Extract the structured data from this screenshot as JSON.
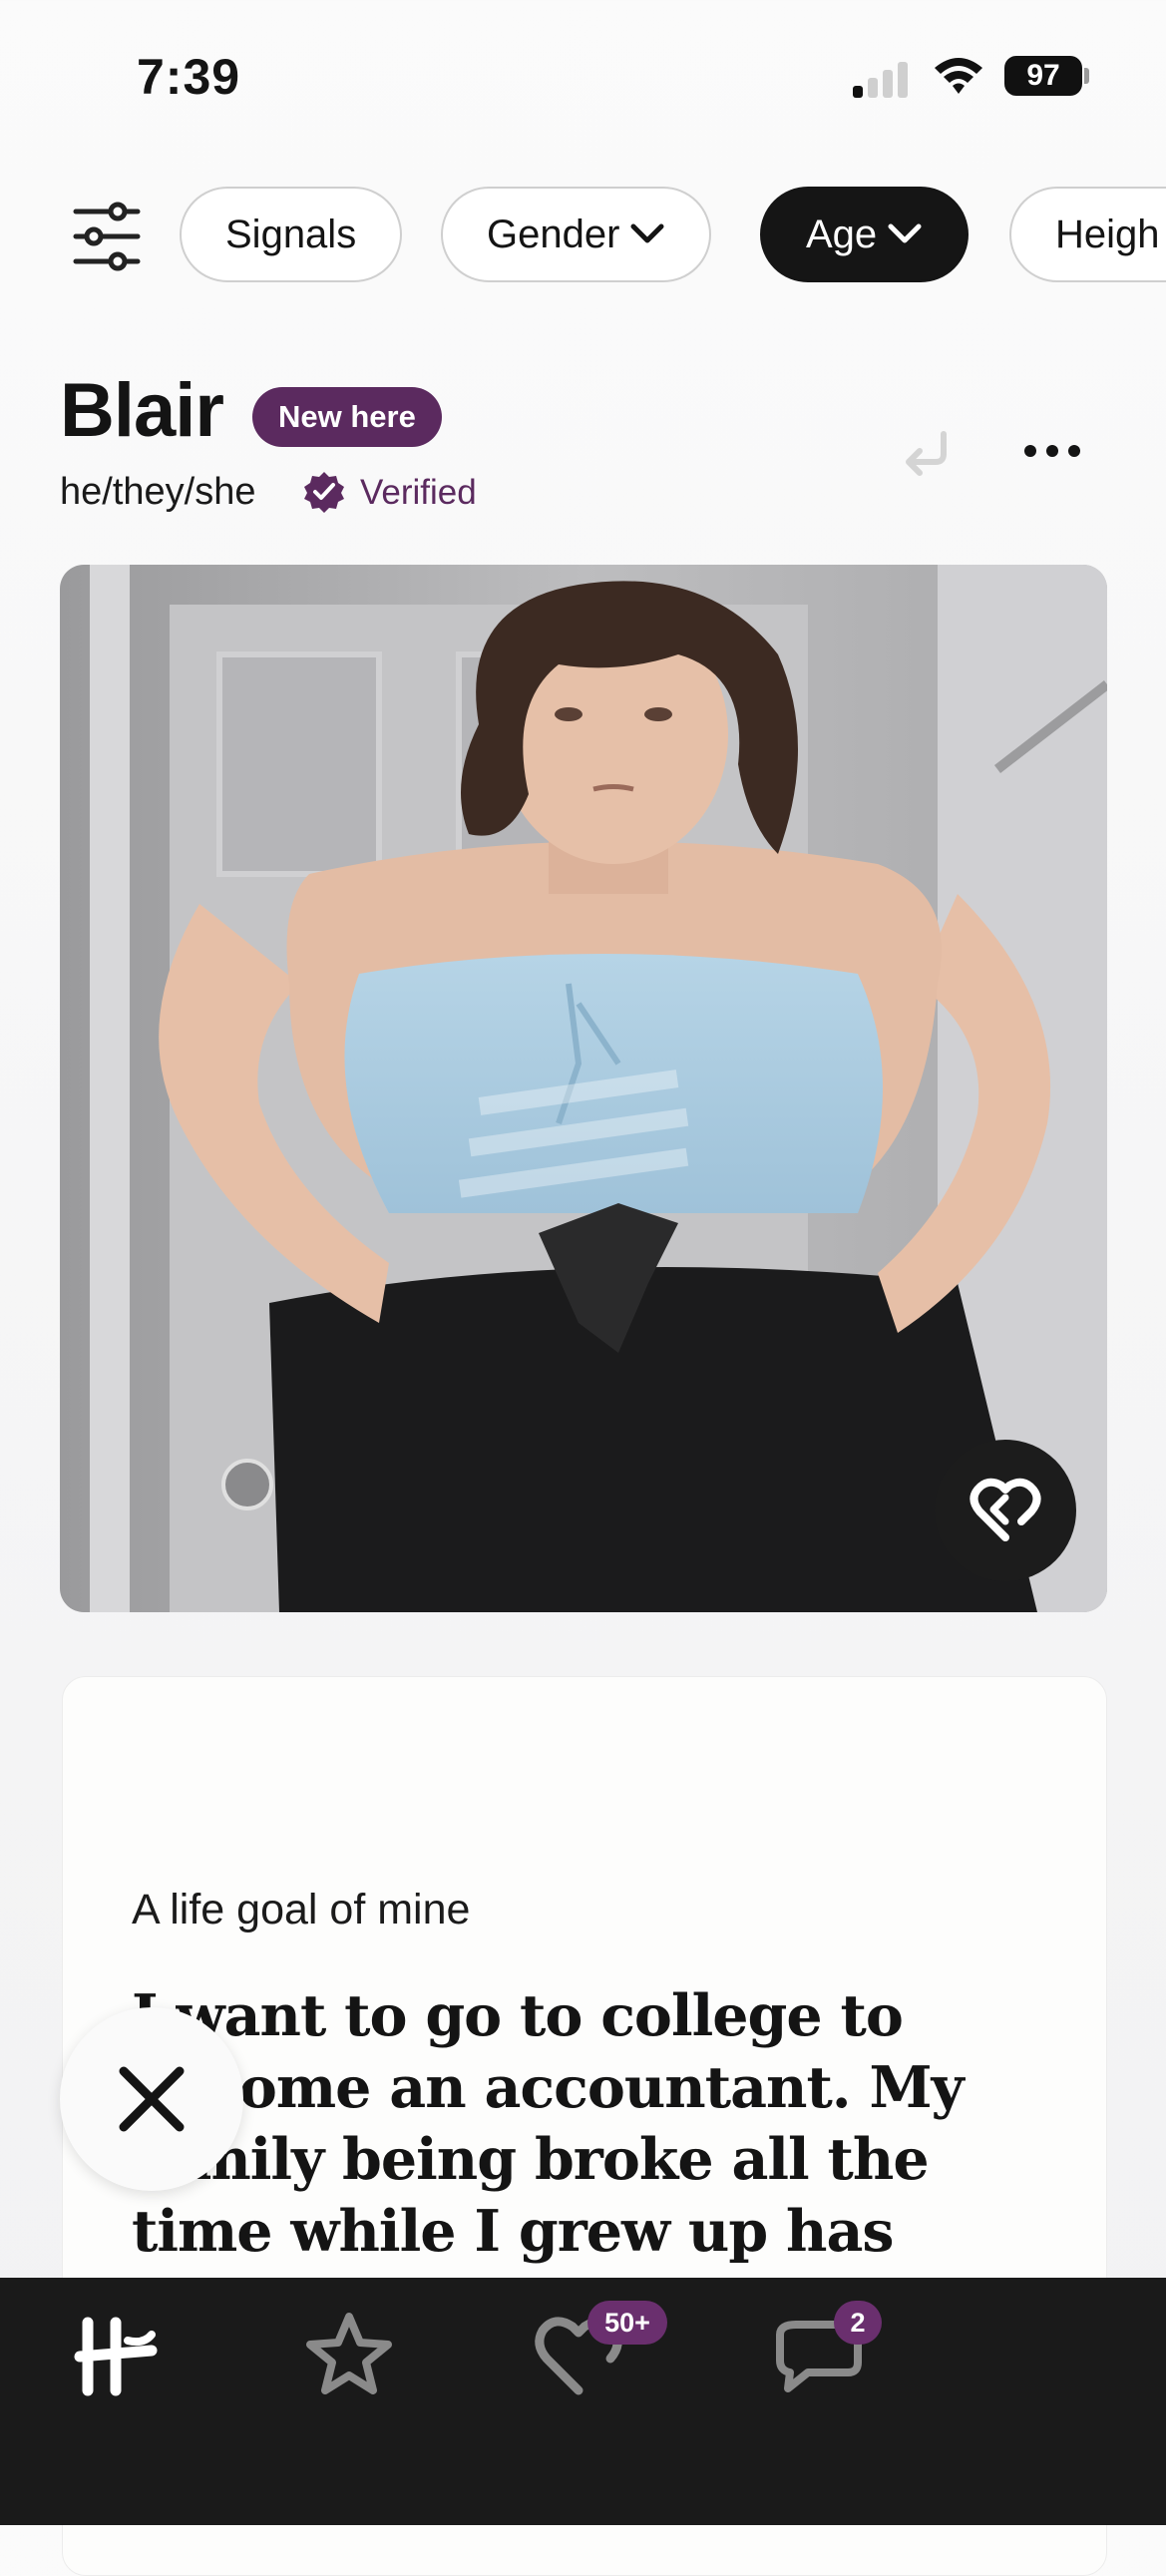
{
  "status_bar": {
    "time": "7:39",
    "battery": "97"
  },
  "filters": {
    "chips": [
      {
        "label": "Signals",
        "active": false
      },
      {
        "label": "Gender",
        "active": false,
        "dropdown": true
      },
      {
        "label": "Age",
        "active": true,
        "dropdown": true
      },
      {
        "label": "Heigh",
        "active": false
      }
    ]
  },
  "profile": {
    "name": "Blair",
    "new_badge": "New here",
    "pronouns": "he/they/she",
    "verified_label": "Verified"
  },
  "prompt": {
    "label": "A life goal of mine",
    "answer": "I want to go to college to become an accountant. My family being broke all the time while I grew up has made me want to change that"
  },
  "tab_bar": {
    "likes_badge": "50+",
    "messages_badge": "2"
  },
  "colors": {
    "brand_purple": "#5b2a5f",
    "tab_bar_bg": "#1a1a1a",
    "active_chip_bg": "#151515"
  },
  "icons": {
    "filter": "sliders-icon",
    "undo": "undo-icon",
    "more": "ellipsis-icon",
    "like": "heart-icon",
    "skip": "x-icon",
    "home": "hinge-logo-icon",
    "standouts": "star-icon",
    "likes": "heart-outline-icon",
    "messages": "chat-icon"
  }
}
